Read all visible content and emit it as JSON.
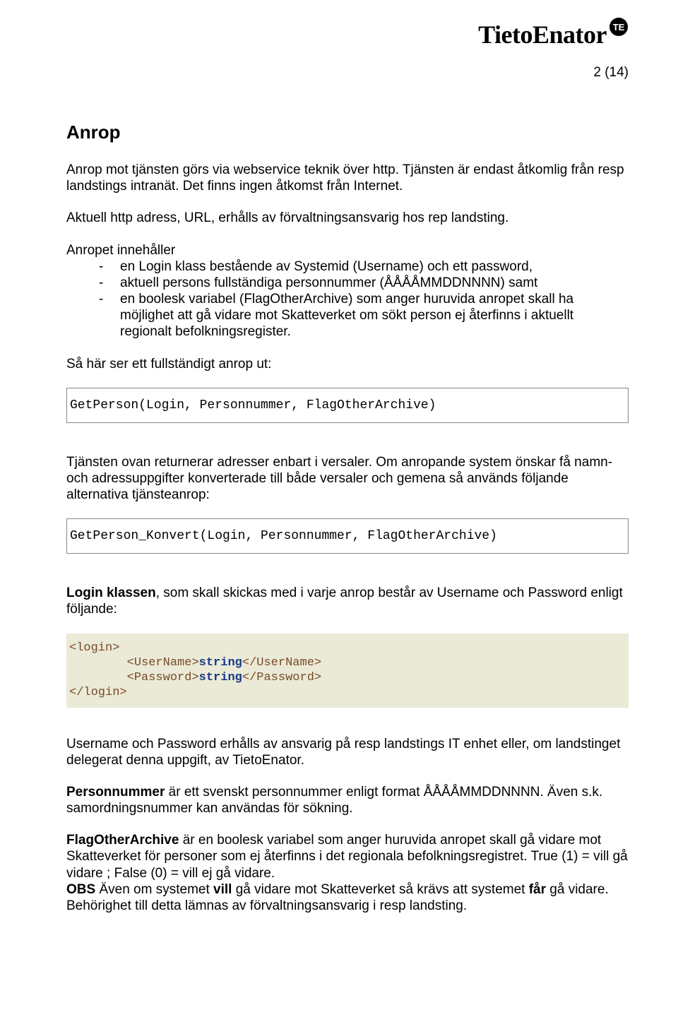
{
  "logo": {
    "text": "TietoEnator",
    "badge": "TE"
  },
  "page_number": "2 (14)",
  "title": "Anrop",
  "p1": "Anrop mot tjänsten görs via webservice teknik över http. Tjänsten är endast åtkomlig från resp landstings intranät. Det finns ingen åtkomst från Internet.",
  "p2": "Aktuell http adress, URL, erhålls av förvaltningsansvarig hos rep landsting.",
  "list_intro": "Anropet innehåller",
  "list_items": [
    "en Login klass bestående av Systemid (Username) och ett password,",
    "aktuell persons fullständiga personnummer (ÅÅÅÅMMDDNNNN) samt",
    "en boolesk variabel (FlagOtherArchive) som anger huruvida anropet skall ha möjlighet att gå vidare mot Skatteverket om sökt person ej återfinns i aktuellt regionalt befolkningsregister."
  ],
  "p_fullcall": "Så här ser ett fullständigt anrop ut:",
  "code1": "GetPerson(Login, Personnummer, FlagOtherArchive)",
  "p_konvert": "Tjänsten ovan returnerar adresser enbart i versaler. Om anropande system önskar få namn- och adressuppgifter konverterade till både versaler och gemena så används följande alternativa tjänsteanrop:",
  "code2": "GetPerson_Konvert(Login, Personnummer, FlagOtherArchive)",
  "p_login_lead": "Login klassen",
  "p_login_rest": ", som skall skickas med i varje anrop består av Username och Password enligt följande:",
  "xml": {
    "open": "<login>",
    "user_open": "<UserName>",
    "user_val": "string",
    "user_close": "</UserName>",
    "pass_open": "<Password>",
    "pass_val": "string",
    "pass_close": "</Password>",
    "close": "</login>"
  },
  "p_up": "Username och Password erhålls av ansvarig på resp landstings IT enhet eller, om landstinget delegerat denna uppgift, av TietoEnator.",
  "p_pnr_lead": "Personnummer",
  "p_pnr_rest": " är ett svenskt personnummer enligt format ÅÅÅÅMMDDNNNN. Även s.k. samordningsnummer kan användas för sökning.",
  "p_flag_lead": "FlagOtherArchive",
  "p_flag_rest": " är en boolesk variabel som anger huruvida anropet skall gå vidare mot Skatteverket för personer som ej återfinns i det regionala befolkningsregistret. True (1) = vill gå vidare ; False (0) = vill ej gå vidare.",
  "p_obs_lead": "OBS",
  "p_obs_mid1": " Även om systemet ",
  "p_obs_vill": "vill",
  "p_obs_mid2": " gå vidare mot Skatteverket så krävs att systemet ",
  "p_obs_far": "får",
  "p_obs_mid3": " gå vidare. Behörighet till detta lämnas av förvaltningsansvarig i resp landsting."
}
